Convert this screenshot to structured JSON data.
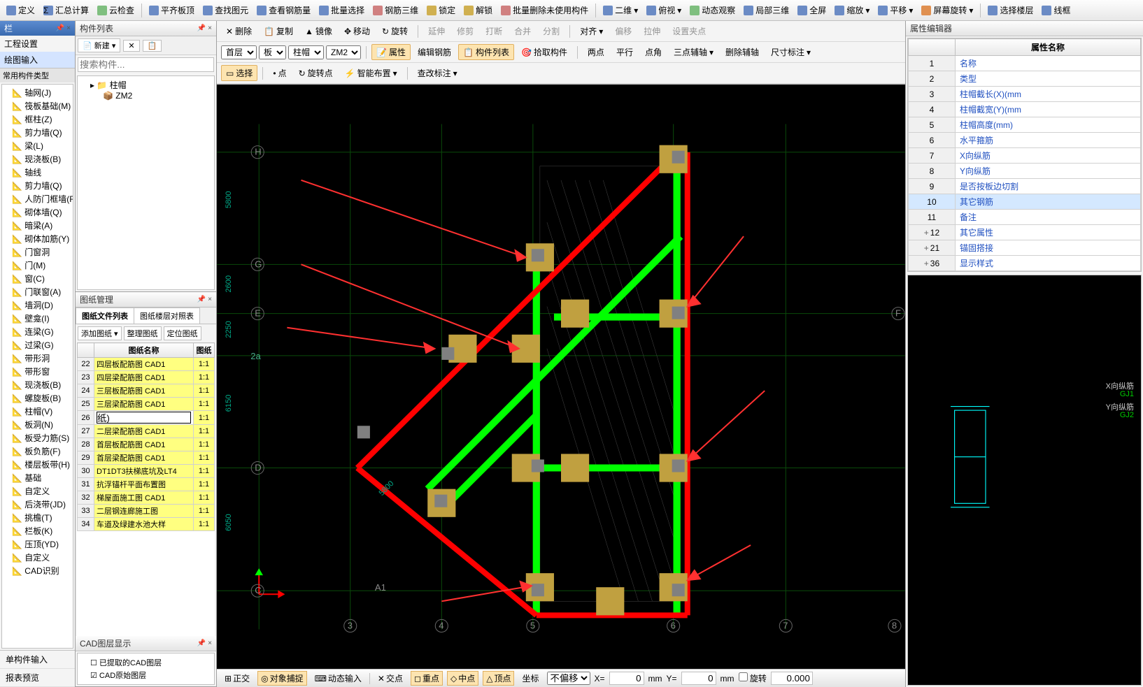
{
  "topbar": {
    "items": [
      "定义",
      "汇总计算",
      "云检查",
      "平齐板顶",
      "查找图元",
      "查看钢筋量",
      "批量选择",
      "钢筋三维",
      "锁定",
      "解锁",
      "批量删除未使用构件",
      "二维",
      "俯视",
      "动态观察",
      "局部三维",
      "全屏",
      "缩放",
      "平移",
      "屏幕旋转",
      "选择楼层",
      "线框"
    ]
  },
  "left_header": "栏",
  "left_nav": {
    "a": "工程设置",
    "b": "绘图输入"
  },
  "left_tree_title": "常用构件类型",
  "left_tree": [
    "轴网(J)",
    "筏板基础(M)",
    "框柱(Z)",
    "剪力墙(Q)",
    "梁(L)",
    "现浇板(B)",
    "轴线",
    "剪力墙(Q)",
    "人防门框墙(RF)",
    "砌体墙(Q)",
    "暗梁(A)",
    "砌体加筋(Y)",
    "门窗洞",
    "门(M)",
    "窗(C)",
    "门联窗(A)",
    "墙洞(D)",
    "壁龛(I)",
    "连梁(G)",
    "过梁(G)",
    "带形洞",
    "带形窗",
    "现浇板(B)",
    "螺旋板(B)",
    "柱帽(V)",
    "板洞(N)",
    "板受力筋(S)",
    "板负筋(F)",
    "楼层板带(H)",
    "基础",
    "自定义",
    "后浇带(JD)",
    "挑檐(T)",
    "栏板(K)",
    "压顶(YD)",
    "自定义",
    "CAD识别"
  ],
  "left_bottom": {
    "a": "单构件输入",
    "b": "报表预览"
  },
  "component_list": {
    "title": "构件列表",
    "new_btn": "新建",
    "search_ph": "搜索构件...",
    "root": "柱帽",
    "child": "ZM2"
  },
  "drawing_mgr": {
    "title": "图纸管理",
    "tab1": "图纸文件列表",
    "tab2": "图纸楼层对照表",
    "btn1": "添加图纸",
    "btn2": "整理图纸",
    "btn3": "定位图纸",
    "col1": "图纸名称",
    "col2": "图纸",
    "rows": [
      {
        "n": 22,
        "name": "四层板配筋图 CAD1",
        "s": "1:1"
      },
      {
        "n": 23,
        "name": "四层梁配筋图 CAD1",
        "s": "1:1"
      },
      {
        "n": 24,
        "name": "三层板配筋图 CAD1",
        "s": "1:1"
      },
      {
        "n": 25,
        "name": "三层梁配筋图 CAD1",
        "s": "1:1"
      },
      {
        "n": 26,
        "name": "纸)",
        "s": "1:1",
        "editing": true
      },
      {
        "n": 27,
        "name": "二层梁配筋图 CAD1",
        "s": "1:1"
      },
      {
        "n": 28,
        "name": "首层板配筋图 CAD1",
        "s": "1:1"
      },
      {
        "n": 29,
        "name": "首层梁配筋图 CAD1",
        "s": "1:1"
      },
      {
        "n": 30,
        "name": "DT1DT3扶梯底坑及LT4",
        "s": "1:1"
      },
      {
        "n": 31,
        "name": "抗浮锚杆平面布置图",
        "s": "1:1"
      },
      {
        "n": 32,
        "name": "梯屋面施工图 CAD1",
        "s": "1:1"
      },
      {
        "n": 33,
        "name": "二层钢连廊施工图",
        "s": "1:1"
      },
      {
        "n": 34,
        "name": "车道及绿建水池大样",
        "s": "1:1"
      }
    ]
  },
  "cad_layer": {
    "title": "CAD图层显示",
    "a": "已提取的CAD图层",
    "b": "CAD原始图层"
  },
  "canvas_tb1": {
    "del": "删除",
    "copy": "复制",
    "mirror": "镜像",
    "move": "移动",
    "rotate": "旋转",
    "extend": "延伸",
    "trim": "修剪",
    "break": "打断",
    "merge": "合并",
    "split": "分割",
    "align": "对齐",
    "offset": "偏移",
    "stretch": "拉伸",
    "grip": "设置夹点"
  },
  "canvas_tb2": {
    "floor": "首层",
    "cat": "板",
    "sub": "柱帽",
    "item": "ZM2",
    "attr": "属性",
    "editbar": "编辑钢筋",
    "complist": "构件列表",
    "pick": "拾取构件",
    "p2": "两点",
    "par": "平行",
    "pang": "点角",
    "p3": "三点辅轴",
    "delaux": "删除辅轴",
    "dim": "尺寸标注"
  },
  "canvas_tb3": {
    "select": "选择",
    "point": "点",
    "rotpt": "旋转点",
    "smart": "智能布置",
    "modify": "查改标注"
  },
  "canvas_labels": {
    "H": "H",
    "G": "G",
    "E": "E",
    "D": "D",
    "C": "C",
    "F": "F",
    "n3": "3",
    "n4": "4",
    "n5": "5",
    "n6": "6",
    "n7": "7",
    "n8": "8",
    "a2a": "2a",
    "A1": "A1",
    "d5800": "5800",
    "d2600": "2600",
    "d2250": "2250",
    "d6150": "6150",
    "d6050": "6050",
    "d5800b": "5800"
  },
  "status": {
    "ortho": "正交",
    "osnap": "对象捕捉",
    "dyn": "动态输入",
    "int": "交点",
    "mid": "重点",
    "cen": "中点",
    "end": "顶点",
    "coord": "坐标",
    "nooff": "不偏移",
    "xlbl": "X=",
    "xval": "0",
    "xmm": "mm",
    "ylbl": "Y=",
    "yval": "0",
    "ymm": "mm",
    "rot": "旋转",
    "rotval": "0.000"
  },
  "props": {
    "title": "属性编辑器",
    "col": "属性名称",
    "rows": [
      {
        "n": 1,
        "k": "名称"
      },
      {
        "n": 2,
        "k": "类型"
      },
      {
        "n": 3,
        "k": "柱帽截长(X)(mm"
      },
      {
        "n": 4,
        "k": "柱帽截宽(Y)(mm"
      },
      {
        "n": 5,
        "k": "柱帽高度(mm)"
      },
      {
        "n": 6,
        "k": "水平箍筋"
      },
      {
        "n": 7,
        "k": "X向纵筋"
      },
      {
        "n": 8,
        "k": "Y向纵筋"
      },
      {
        "n": 9,
        "k": "是否按板边切割"
      },
      {
        "n": 10,
        "k": "其它钢筋",
        "sel": true
      },
      {
        "n": 11,
        "k": "备注"
      },
      {
        "n": 12,
        "k": "其它属性",
        "exp": true
      },
      {
        "n": 21,
        "k": "锚固搭接",
        "exp": true
      },
      {
        "n": 36,
        "k": "显示样式",
        "exp": true
      }
    ]
  },
  "preview": {
    "x": "X向纵筋",
    "xg": "GJ1",
    "y": "Y向纵筋",
    "yg": "GJ2"
  }
}
